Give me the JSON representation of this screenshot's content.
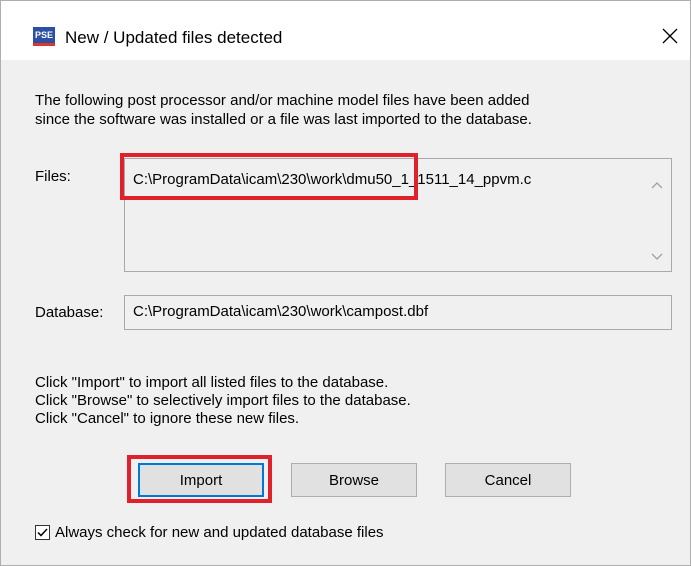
{
  "window": {
    "title": "New / Updated files detected",
    "icon_text": "PSE",
    "close_icon": "close-icon"
  },
  "intro": {
    "line1": "The following post processor and/or machine model files have been added",
    "line2": "since the software was installed or a file was last imported to the database."
  },
  "files": {
    "label": "Files:",
    "value": "C:\\ProgramData\\icam\\230\\work\\dmu50_1_1511_14_ppvm.c"
  },
  "database": {
    "label": "Database:",
    "value": "C:\\ProgramData\\icam\\230\\work\\campost.dbf"
  },
  "instructions": {
    "line1": "Click \"Import\" to import all listed files to the database.",
    "line2": "Click \"Browse\" to selectively import files to the database.",
    "line3": "Click \"Cancel\" to ignore these new files."
  },
  "buttons": {
    "import": "Import",
    "browse": "Browse",
    "cancel": "Cancel"
  },
  "checkbox": {
    "label": "Always check for new and updated database files",
    "checked": true
  },
  "colors": {
    "highlight": "#e0202b",
    "focus_border": "#0078d7"
  }
}
